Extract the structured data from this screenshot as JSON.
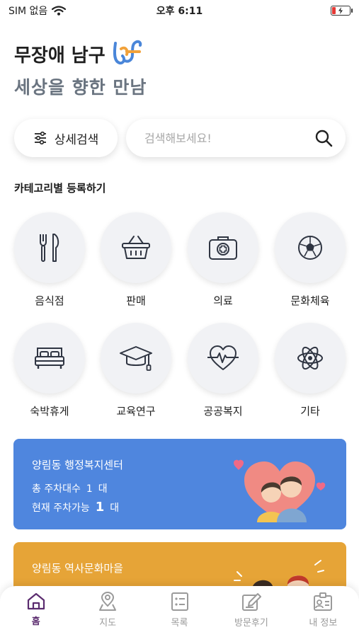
{
  "status_bar": {
    "carrier": "SIM 없음",
    "time": "오후 6:11"
  },
  "header": {
    "title": "무장애 남구",
    "tagline": "세상을 향한 만남"
  },
  "search": {
    "filter_label": "상세검색",
    "placeholder": "검색해보세요!"
  },
  "categories_section": {
    "title": "카테고리별 등록하기",
    "items": [
      {
        "label": "음식점",
        "icon": "utensils-icon"
      },
      {
        "label": "판매",
        "icon": "shopping-basket-icon"
      },
      {
        "label": "의료",
        "icon": "first-aid-kit-icon"
      },
      {
        "label": "문화체육",
        "icon": "soccer-ball-icon"
      },
      {
        "label": "숙박휴게",
        "icon": "bed-icon"
      },
      {
        "label": "교육연구",
        "icon": "graduation-cap-icon"
      },
      {
        "label": "공공복지",
        "icon": "heartbeat-icon"
      },
      {
        "label": "기타",
        "icon": "atom-icon"
      }
    ]
  },
  "cards": [
    {
      "title": "양림동 행정복지센터",
      "total_label": "총 주차대수",
      "total_value": "1",
      "total_unit": "대",
      "available_label": "현재 주차가능",
      "available_value": "1",
      "available_unit": "대",
      "color": "#4f86de"
    },
    {
      "title": "양림동 역사문화마을",
      "color": "#e6a437"
    }
  ],
  "tab_bar": {
    "active": "홈",
    "items": [
      {
        "label": "홈",
        "icon": "home-icon"
      },
      {
        "label": "지도",
        "icon": "map-pin-icon"
      },
      {
        "label": "목록",
        "icon": "list-icon"
      },
      {
        "label": "방문후기",
        "icon": "review-icon"
      },
      {
        "label": "내 정보",
        "icon": "profile-card-icon"
      }
    ]
  }
}
